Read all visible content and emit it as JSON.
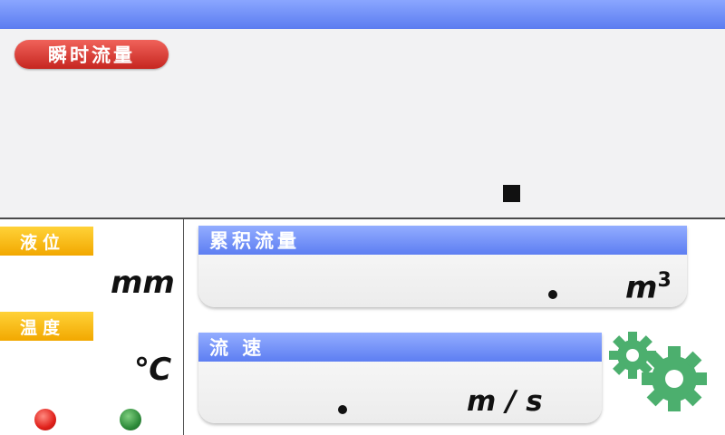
{
  "top_bar": {
    "color": "#6b8af5"
  },
  "instant_flow": {
    "title": "瞬时流量",
    "title_color": "#d9322b"
  },
  "level": {
    "label": "液位",
    "unit": "mm"
  },
  "temperature": {
    "label": "温度",
    "unit": "℃"
  },
  "cumulative_flow": {
    "title": "累积流量",
    "unit": "m",
    "unit_sup": "3"
  },
  "velocity": {
    "title": "流  速",
    "unit": "m / s"
  },
  "indicators": {
    "red": "#e0201a",
    "green": "#2e8b3a"
  },
  "settings": {
    "icon": "gears-icon",
    "color": "#4caf6e"
  }
}
